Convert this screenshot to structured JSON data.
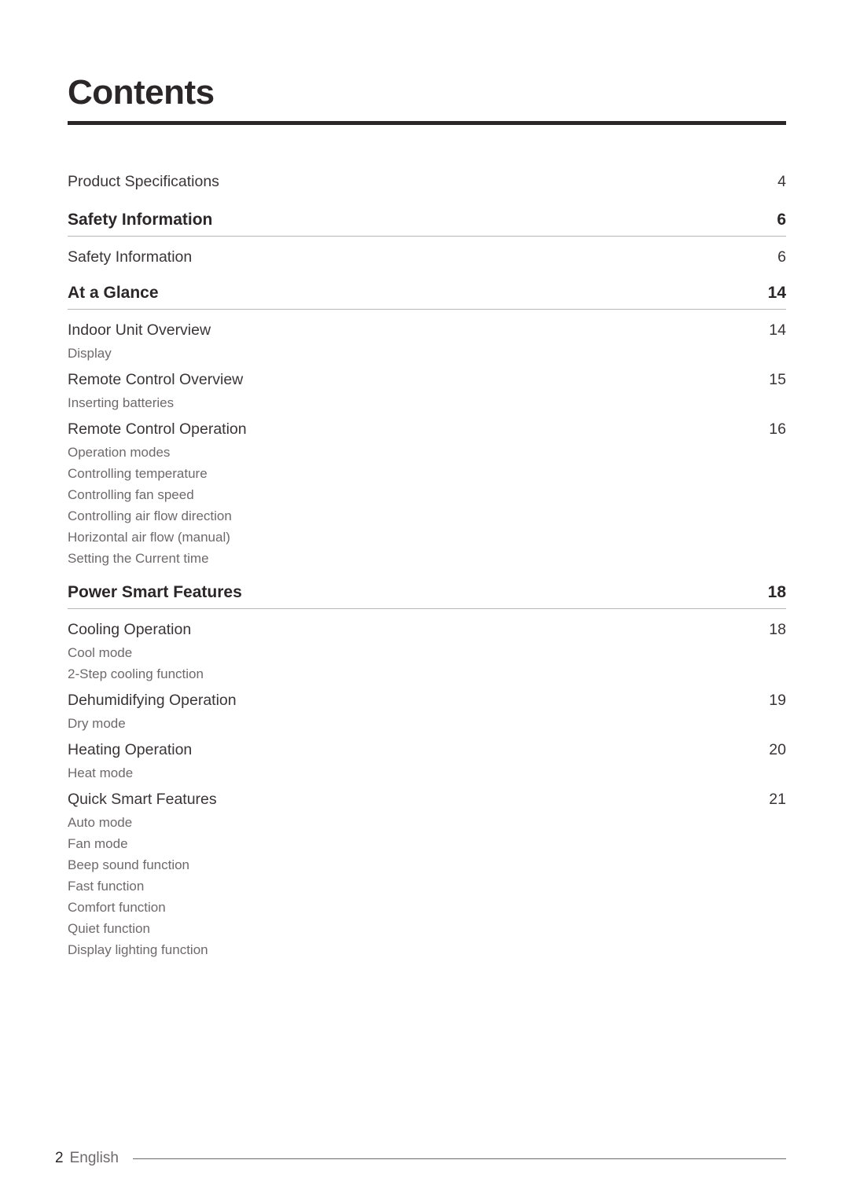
{
  "document": {
    "title": "Contents",
    "footer": {
      "page_number": "2",
      "language": "English"
    },
    "colors": {
      "title_rule": "#2b2627",
      "section_rule": "#b9b6b6",
      "body_text": "#3a3536",
      "sub_text": "#6e6a6b"
    }
  },
  "toc": {
    "rows": [
      {
        "kind": "top",
        "label": "Product Specifications",
        "page": "4"
      },
      {
        "kind": "section",
        "label": "Safety Information",
        "page": "6"
      },
      {
        "kind": "entry",
        "label": "Safety Information",
        "page": "6"
      },
      {
        "kind": "section",
        "label": "At a Glance",
        "page": "14"
      },
      {
        "kind": "entry",
        "label": "Indoor Unit Overview",
        "page": "14"
      },
      {
        "kind": "sub",
        "label": "Display",
        "page": ""
      },
      {
        "kind": "entry",
        "label": "Remote Control Overview",
        "page": "15"
      },
      {
        "kind": "sub",
        "label": "Inserting batteries",
        "page": ""
      },
      {
        "kind": "entry",
        "label": "Remote Control Operation",
        "page": "16"
      },
      {
        "kind": "sub",
        "label": "Operation modes",
        "page": ""
      },
      {
        "kind": "sub",
        "label": "Controlling temperature",
        "page": ""
      },
      {
        "kind": "sub",
        "label": "Controlling fan speed",
        "page": ""
      },
      {
        "kind": "sub",
        "label": "Controlling air flow direction",
        "page": ""
      },
      {
        "kind": "sub",
        "label": "Horizontal air flow (manual)",
        "page": ""
      },
      {
        "kind": "sub",
        "label": "Setting the Current time",
        "page": ""
      },
      {
        "kind": "section",
        "label": "Power Smart Features",
        "page": "18"
      },
      {
        "kind": "entry",
        "label": "Cooling Operation",
        "page": "18"
      },
      {
        "kind": "sub",
        "label": "Cool mode",
        "page": ""
      },
      {
        "kind": "sub",
        "label": "2-Step cooling function",
        "page": ""
      },
      {
        "kind": "entry",
        "label": "Dehumidifying Operation",
        "page": "19"
      },
      {
        "kind": "sub",
        "label": "Dry mode",
        "page": ""
      },
      {
        "kind": "entry",
        "label": "Heating Operation",
        "page": "20"
      },
      {
        "kind": "sub",
        "label": "Heat mode",
        "page": ""
      },
      {
        "kind": "entry",
        "label": "Quick Smart Features",
        "page": "21"
      },
      {
        "kind": "sub",
        "label": "Auto mode",
        "page": ""
      },
      {
        "kind": "sub",
        "label": "Fan mode",
        "page": ""
      },
      {
        "kind": "sub",
        "label": "Beep sound function",
        "page": ""
      },
      {
        "kind": "sub",
        "label": "Fast function",
        "page": ""
      },
      {
        "kind": "sub",
        "label": "Comfort function",
        "page": ""
      },
      {
        "kind": "sub",
        "label": "Quiet function",
        "page": ""
      },
      {
        "kind": "sub",
        "label": "Display lighting function",
        "page": ""
      }
    ]
  }
}
